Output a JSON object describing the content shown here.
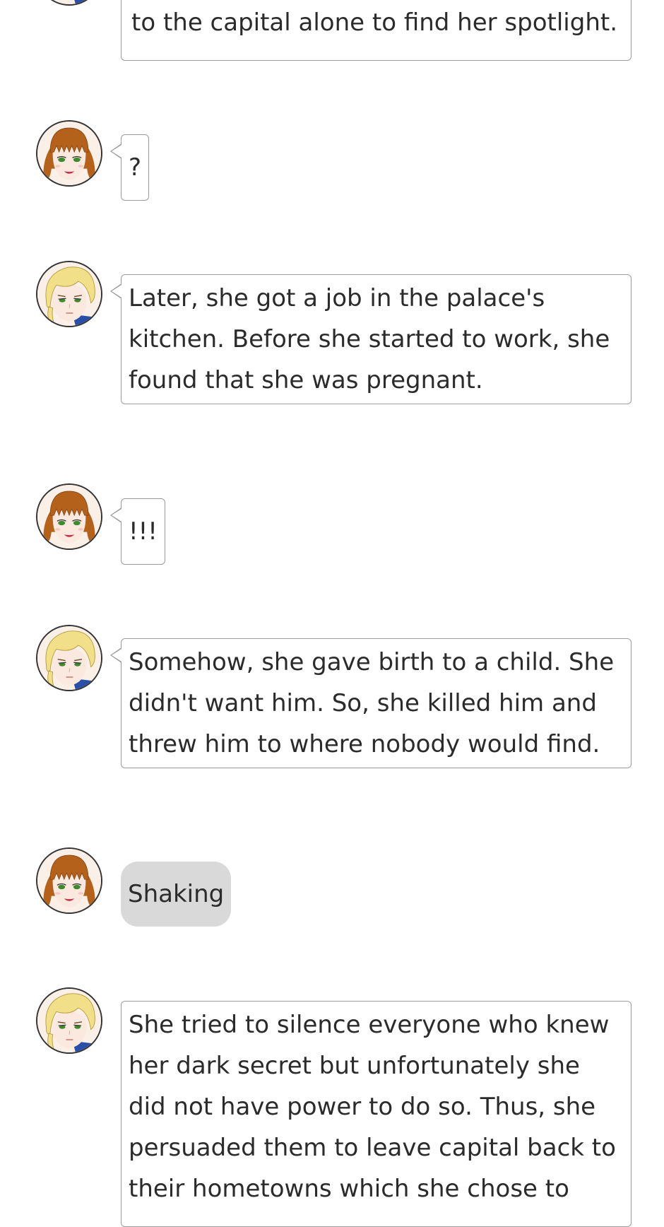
{
  "messages": [
    {
      "speaker": "narrator",
      "type": "speech",
      "text": "to the capital alone to find her spotlight."
    },
    {
      "speaker": "girl",
      "type": "speech",
      "text": "?"
    },
    {
      "speaker": "narrator",
      "type": "speech",
      "text": "Later, she got a job in the palace's kitchen. Before she started to work, she found that she was pregnant."
    },
    {
      "speaker": "girl",
      "type": "speech",
      "text": "!!!"
    },
    {
      "speaker": "narrator",
      "type": "speech",
      "text": "Somehow, she gave birth to a child. She didn't want him. So, she killed him and threw him to where nobody would find."
    },
    {
      "speaker": "girl",
      "type": "action",
      "text": "Shaking"
    },
    {
      "speaker": "narrator",
      "type": "speech",
      "text": "She tried to silence everyone who knew her dark secret but unfortunately she did not have power to do so. Thus, she persuaded them to leave capital back to their hometowns which she chose to"
    }
  ],
  "avatars": {
    "narrator": {
      "icon": "blonde-boy-avatar-icon",
      "hair": "#f2df8a",
      "skin": "#fbe9df",
      "eyes": "#3f8a2f"
    },
    "girl": {
      "icon": "auburn-girl-avatar-icon",
      "hair": "#b4621b",
      "skin": "#fbe9df",
      "eyes": "#3f8a2f",
      "lips": "#c9304a"
    }
  },
  "colors": {
    "bubble_border": "#9a9a9a",
    "action_bg": "#d9d9d9",
    "text": "#2b2b2b"
  }
}
